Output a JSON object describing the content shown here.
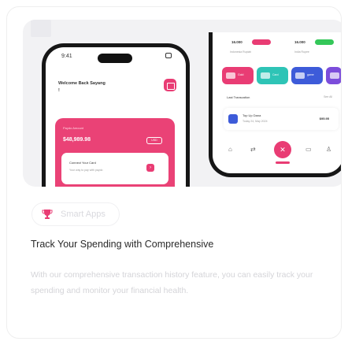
{
  "badge": {
    "label": "Smart Apps",
    "icon": "trophy-icon",
    "icon_color": "#e93c74"
  },
  "headline": "Track Your Spending with Comprehensive",
  "description": "With our comprehensive transaction history feature, you can easily track your spending and monitor your financial health.",
  "phone1": {
    "status_time": "9:41",
    "welcome": "Welcome Back Sayang !",
    "balance_label": "Paydo Amount",
    "balance_amount": "$48,989.98",
    "currency": "USD",
    "connect_title": "Connect Your Card",
    "connect_sub": "Your way to pay with paydo"
  },
  "phone2": {
    "amount_left": "16.000",
    "amount_right": "16.000",
    "wallet_left": "Indonesia Rupiah",
    "wallet_right": "India Rupee",
    "chips": [
      {
        "label": "Gold",
        "color": "#e93c74"
      },
      {
        "label": "Card",
        "color": "#2ec4b6"
      },
      {
        "label": "game",
        "color": "#3d5bd9"
      }
    ],
    "last_txn_title": "Last Transcation",
    "see_all": "See All",
    "txn_name": "Top Up Dana",
    "txn_date": "Today 24, May 2024",
    "txn_amount": "$95.95"
  },
  "colors": {
    "accent": "#e93c74",
    "hero_bg": "#f2f2f4"
  }
}
